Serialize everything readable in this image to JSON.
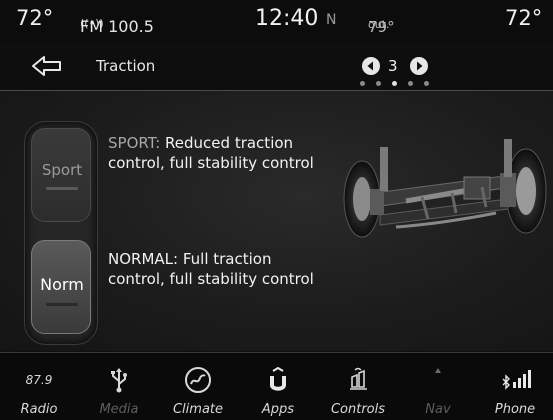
{
  "status": {
    "temp_left": "72°",
    "radio_icon": "antenna-icon",
    "radio_station": "FM 100.5",
    "clock": "12:40",
    "compass": "N",
    "outside_temp": "79°",
    "outside_label": "out.",
    "temp_right": "72°"
  },
  "title_bar": {
    "back_icon": "back-arrow-icon",
    "title": "Traction",
    "page": "3",
    "page_dots_total": 5,
    "page_dot_active": 3
  },
  "modes": {
    "sport": {
      "button_label": "Sport",
      "name": "SPORT:",
      "description": " Reduced traction control, full stability control"
    },
    "normal": {
      "button_label": "Norm",
      "name": "NORMAL:",
      "description": " Full traction control, full stability control"
    },
    "selected": "normal"
  },
  "nav": [
    {
      "label": "Radio",
      "icon": "87.9",
      "active": true
    },
    {
      "label": "Media",
      "icon": "usb-icon",
      "active": false
    },
    {
      "label": "Climate",
      "icon": "climate-icon",
      "active": true
    },
    {
      "label": "Apps",
      "icon": "apps-icon",
      "active": true
    },
    {
      "label": "Controls",
      "icon": "controls-icon",
      "active": true
    },
    {
      "label": "Nav",
      "icon": "nav-icon",
      "active": false
    },
    {
      "label": "Phone",
      "icon": "phone-icon",
      "active": true
    }
  ],
  "colors": {
    "background": "#101010",
    "text": "#e8e8e8",
    "dim_text": "#5e5e5e",
    "selected_button": "#5a5a5a"
  }
}
